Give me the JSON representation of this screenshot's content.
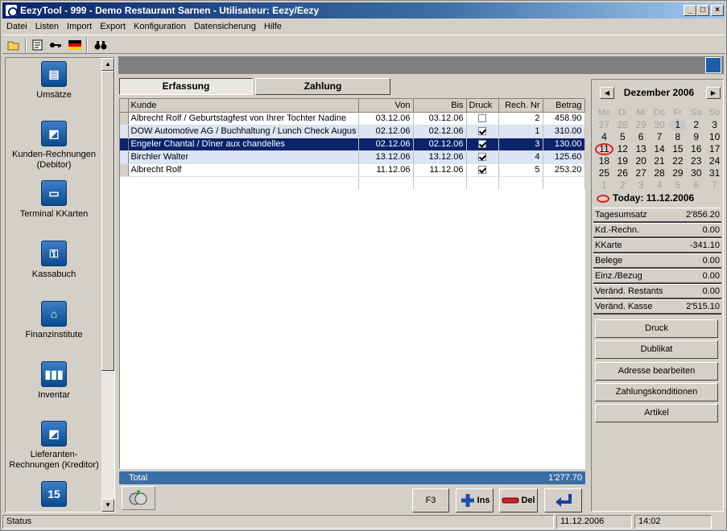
{
  "window": {
    "title": "EezyTool - 999 - Demo Restaurant Sarnen - Utilisateur: Eezy/Eezy"
  },
  "menu": [
    "Datei",
    "Listen",
    "Import",
    "Export",
    "Konfiguration",
    "Datensicherung",
    "Hilfe"
  ],
  "sidebar": {
    "items": [
      {
        "label": "Umsätze",
        "icon": "register-icon"
      },
      {
        "label": "Kunden-Rechnungen (Debitor)",
        "icon": "invoice-icon"
      },
      {
        "label": "Terminal KKarten",
        "icon": "card-terminal-icon"
      },
      {
        "label": "Kassabuch",
        "icon": "cashbook-icon"
      },
      {
        "label": "Finanzinstitute",
        "icon": "bank-icon"
      },
      {
        "label": "Inventar",
        "icon": "bottles-icon"
      },
      {
        "label": "Lieferanten-Rechnungen (Kreditor)",
        "icon": "supplier-invoice-icon"
      },
      {
        "label": "",
        "icon": "calendar-15-icon"
      }
    ]
  },
  "tabs": [
    {
      "label": "Erfassung",
      "active": true
    },
    {
      "label": "Zahlung",
      "active": false
    }
  ],
  "table": {
    "columns": [
      "Kunde",
      "Von",
      "Bis",
      "Druck",
      "Rech. Nr",
      "Betrag"
    ],
    "rows": [
      {
        "kunde": "Albrecht Rolf / Geburtstagfest von Ihrer Tochter Nadine",
        "von": "03.12.06",
        "bis": "03.12.06",
        "druck": false,
        "nr": "2",
        "betrag": "458.90"
      },
      {
        "kunde": "DOW Automotive AG / Buchhaltung / Lunch Check Augus",
        "von": "02.12.06",
        "bis": "02.12.06",
        "druck": true,
        "nr": "1",
        "betrag": "310.00"
      },
      {
        "kunde": "Engeler Chantal / Dîner aux chandelles",
        "von": "02.12.06",
        "bis": "02.12.06",
        "druck": true,
        "nr": "3",
        "betrag": "130.00"
      },
      {
        "kunde": "Birchler Walter",
        "von": "13.12.06",
        "bis": "13.12.06",
        "druck": true,
        "nr": "4",
        "betrag": "125.60"
      },
      {
        "kunde": "Albrecht Rolf",
        "von": "11.12.06",
        "bis": "11.12.06",
        "druck": true,
        "nr": "5",
        "betrag": "253.20"
      }
    ],
    "selected_row": 2
  },
  "total": {
    "label": "Total",
    "value": "1'277.70"
  },
  "buttons": {
    "f3": "F3",
    "ins": "Ins",
    "del": "Del"
  },
  "calendar": {
    "month": "Dezember 2006",
    "weekdays": [
      "Mo",
      "Di",
      "Mi",
      "Do",
      "Fr",
      "Sa",
      "So"
    ],
    "weeks": [
      [
        "27",
        "28",
        "29",
        "30",
        "1",
        "2",
        "3"
      ],
      [
        "4",
        "5",
        "6",
        "7",
        "8",
        "9",
        "10"
      ],
      [
        "11",
        "12",
        "13",
        "14",
        "15",
        "16",
        "17"
      ],
      [
        "18",
        "19",
        "20",
        "21",
        "22",
        "23",
        "24"
      ],
      [
        "25",
        "26",
        "27",
        "28",
        "29",
        "30",
        "31"
      ],
      [
        "1",
        "2",
        "3",
        "4",
        "5",
        "6",
        "7"
      ]
    ],
    "today_label": "Today: 11.12.2006"
  },
  "stats": [
    {
      "label": "Tagesumsatz",
      "value": "2'856.20"
    },
    {
      "label": "Kd.-Rechn.",
      "value": "0.00"
    },
    {
      "label": "KKarte",
      "value": "-341.10"
    },
    {
      "label": "Belege",
      "value": "0.00"
    },
    {
      "label": "Einz./Bezug",
      "value": "0.00"
    },
    {
      "label": "Veränd. Restants",
      "value": "0.00"
    },
    {
      "label": "Veränd. Kasse",
      "value": "2'515.10"
    }
  ],
  "actions": [
    "Druck",
    "Dublikat",
    "Adresse bearbeiten",
    "Zahlungskonditionen",
    "Artikel"
  ],
  "status": {
    "text": "Status",
    "date": "11.12.2006",
    "time": "14:02"
  },
  "colors": {
    "titlebar": "#0a246a",
    "selected_row": "#0a246a",
    "alt_row": "#dce4f5",
    "total_bar": "#3a6ea5",
    "today_mark": "#e02020"
  }
}
